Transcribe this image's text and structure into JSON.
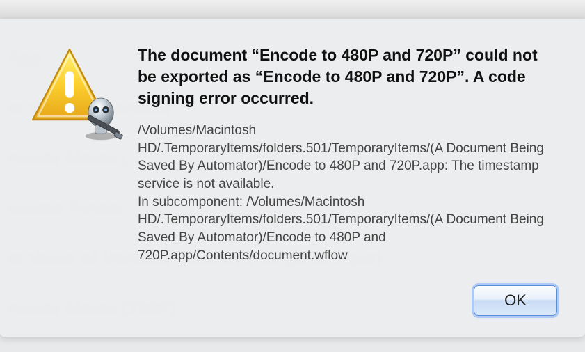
{
  "background": {
    "items": [
      "App",
      "et Value of Variable",
      "ncode Media (",
      "ename Finder",
      "et Value of Variable (Retrieve Original Input)",
      "ncode Media (720P)"
    ]
  },
  "dialog": {
    "headline": "The document “Encode to 480P and 720P” could not be exported as “Encode to 480P and 720P”. A code signing error occurred.",
    "body": "/Volumes/Macintosh HD/.TemporaryItems/folders.501/TemporaryItems/(A Document Being Saved By Automator)/Encode to 480P and 720P.app: The timestamp service is not available.\nIn subcomponent: /Volumes/Macintosh HD/.TemporaryItems/folders.501/TemporaryItems/(A Document Being Saved By Automator)/Encode to 480P and 720P.app/Contents/document.wflow",
    "ok_label": "OK"
  },
  "icons": {
    "warning": "warning-icon",
    "app_badge": "automator-icon"
  }
}
